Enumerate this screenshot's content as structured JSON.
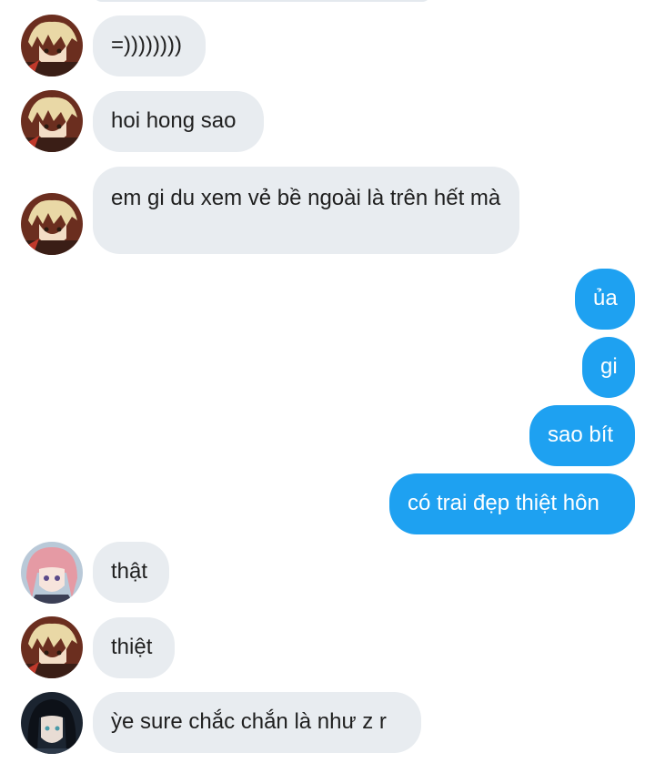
{
  "colors": {
    "incoming_bubble": "#e8ecf0",
    "outgoing_bubble": "#1ea1f1",
    "incoming_text": "#1f1f1f",
    "outgoing_text": "#ffffff"
  },
  "messages": [
    {
      "direction": "incoming",
      "avatar": "avatar-anime-blonde",
      "text": "=))))))))"
    },
    {
      "direction": "incoming",
      "avatar": "avatar-anime-blonde",
      "text": "hoi hong sao"
    },
    {
      "direction": "incoming",
      "avatar": "avatar-anime-blonde",
      "text": "em gi du xem vẻ bề ngoài là trên hết mà"
    },
    {
      "direction": "outgoing",
      "text": "ủa"
    },
    {
      "direction": "outgoing",
      "text": "gi"
    },
    {
      "direction": "outgoing",
      "text": "sao bít"
    },
    {
      "direction": "outgoing",
      "text": "có trai đẹp thiệt hôn"
    },
    {
      "direction": "incoming",
      "avatar": "avatar-anime-pink-hair",
      "text": "thật"
    },
    {
      "direction": "incoming",
      "avatar": "avatar-anime-blonde",
      "text": "thiệt"
    },
    {
      "direction": "incoming",
      "avatar": "avatar-anime-dark-hair",
      "text": "ỳe sure chắc chắn là như z r"
    }
  ]
}
